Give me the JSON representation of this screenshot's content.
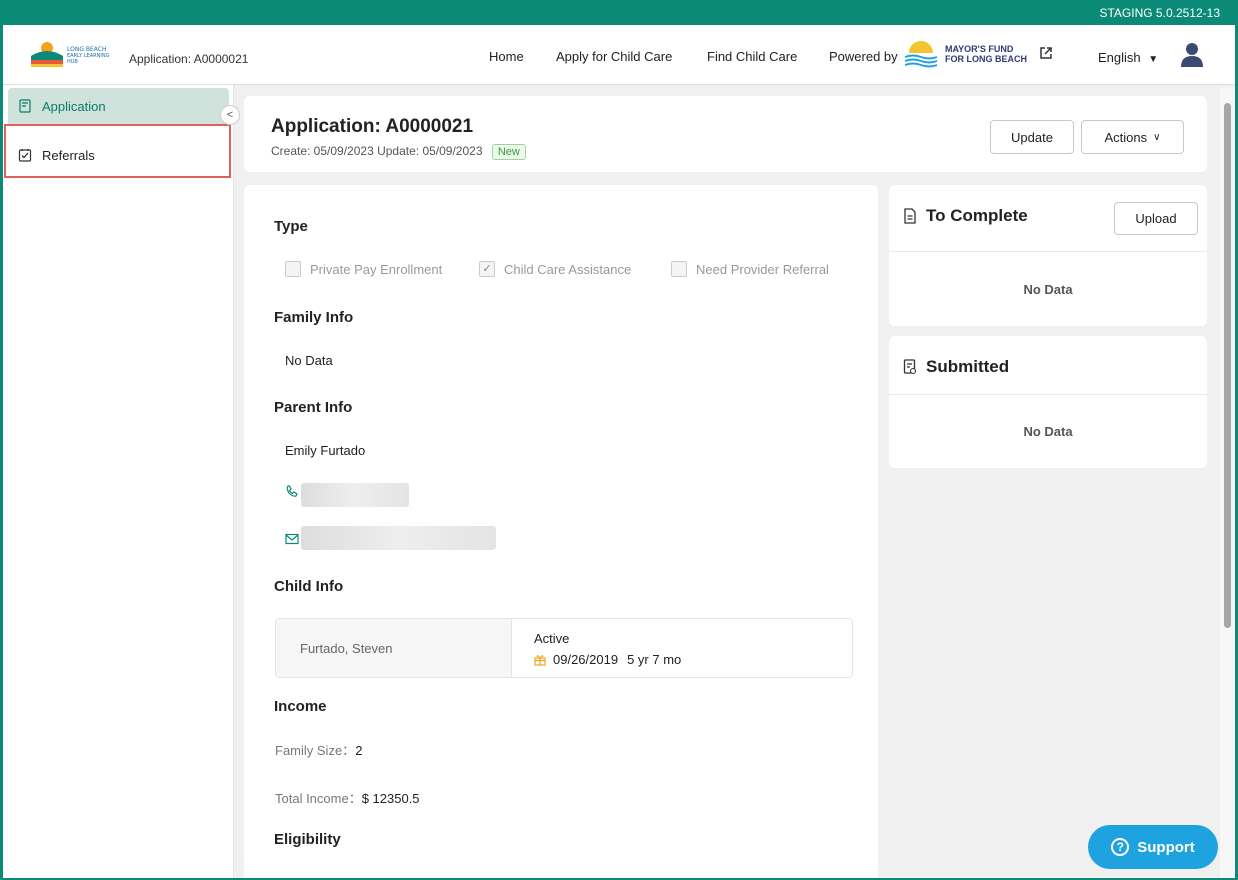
{
  "staging": "STAGING 5.0.2512-13",
  "header": {
    "app_id": "Application: A0000021",
    "nav": [
      "Home",
      "Apply for Child Care",
      "Find Child Care"
    ],
    "powered_by": "Powered by",
    "mayors_fund_line1": "MAYOR'S FUND",
    "mayors_fund_line2": "FOR LONG BEACH",
    "language": "English",
    "logo_line1": "LONG BEACH",
    "logo_line2": "EARLY LEARNING",
    "logo_line3": "HUB"
  },
  "sidebar": {
    "items": [
      {
        "label": "Application",
        "icon": "application-icon"
      },
      {
        "label": "Referrals",
        "icon": "checklist-icon"
      }
    ]
  },
  "app_header": {
    "title": "Application: A0000021",
    "dates": "Create: 05/09/2023   Update: 05/09/2023",
    "status_badge": "New",
    "update_label": "Update",
    "actions_label": "Actions"
  },
  "main": {
    "type_title": "Type",
    "types": [
      {
        "label": "Private Pay Enrollment",
        "checked": false
      },
      {
        "label": "Child Care Assistance",
        "checked": true
      },
      {
        "label": "Need Provider Referral",
        "checked": false
      }
    ],
    "family_title": "Family Info",
    "family_value": "No Data",
    "parent_title": "Parent Info",
    "parent_name": "Emily Furtado",
    "child_title": "Child Info",
    "child_name": "Furtado, Steven",
    "child_status": "Active",
    "child_dob": "09/26/2019",
    "child_age": "5 yr 7 mo",
    "income_title": "Income",
    "family_size_label": "Family Size：",
    "family_size_value": "2",
    "total_income_label": "Total Income：",
    "total_income_value": "$ 12350.5",
    "eligibility_title": "Eligibility"
  },
  "to_complete": {
    "title": "To Complete",
    "upload_label": "Upload",
    "empty": "No Data"
  },
  "submitted": {
    "title": "Submitted",
    "empty": "No Data"
  },
  "support_label": "Support",
  "colors": {
    "brand": "#0b8a78",
    "support": "#1fa2e0",
    "highlight": "#e06060"
  }
}
